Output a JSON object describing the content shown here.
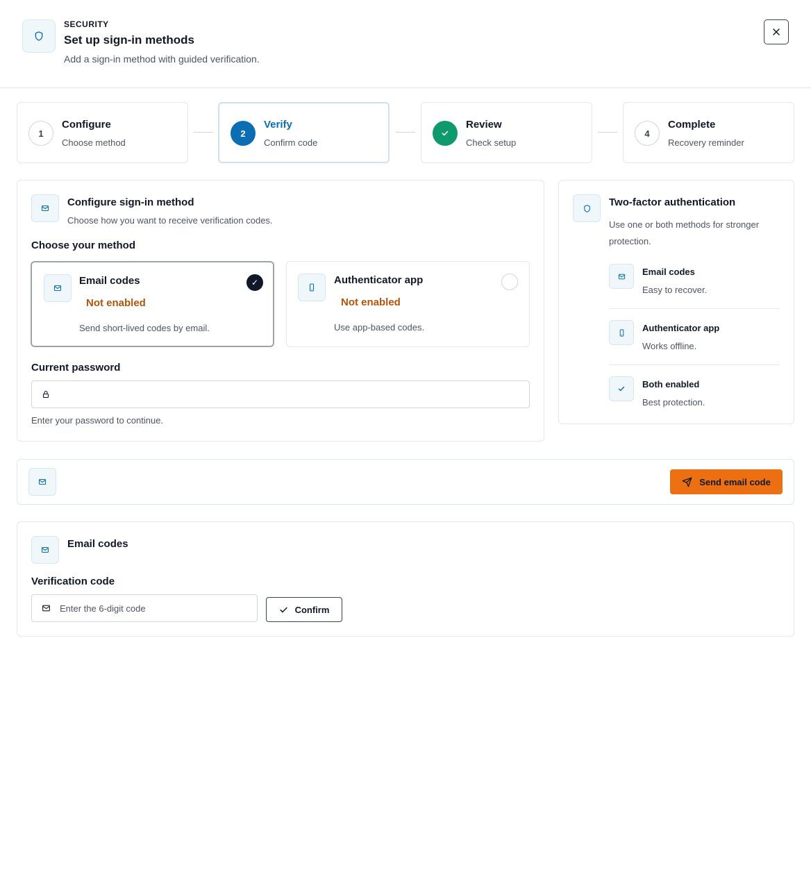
{
  "header": {
    "eyebrow": "SECURITY",
    "title": "Set up sign-in methods",
    "subtitle": "Add a sign-in method with guided verification.",
    "icon": "shield-icon",
    "close_icon": "close-icon"
  },
  "steps": [
    {
      "number": "1",
      "title": "Configure",
      "subtitle": "Choose method",
      "state": "default"
    },
    {
      "number": "2",
      "title": "Verify",
      "subtitle": "Confirm code",
      "state": "active"
    },
    {
      "number": "",
      "title": "Review",
      "subtitle": "Check setup",
      "state": "done"
    },
    {
      "number": "4",
      "title": "Complete",
      "subtitle": "Recovery reminder",
      "state": "default"
    }
  ],
  "configure": {
    "title": "Configure sign-in method",
    "subtitle": "Choose how you want to receive verification codes.",
    "choose_label": "Choose your method",
    "methods": [
      {
        "title": "Email codes",
        "status": "Not enabled",
        "description": "Send short-lived codes by email.",
        "selected": true,
        "icon": "mail-icon"
      },
      {
        "title": "Authenticator app",
        "status": "Not enabled",
        "description": "Use app-based codes.",
        "selected": false,
        "icon": "phone-icon"
      }
    ],
    "password_label": "Current password",
    "password_value": "",
    "password_hint": "Enter your password to continue."
  },
  "sidebar": {
    "title": "Two-factor authentication",
    "description": "Use one or both methods for stronger protection.",
    "items": [
      {
        "title": "Email codes",
        "subtitle": "Easy to recover.",
        "icon": "mail-icon"
      },
      {
        "title": "Authenticator app",
        "subtitle": "Works offline.",
        "icon": "phone-icon"
      },
      {
        "title": "Both enabled",
        "subtitle": "Best protection.",
        "icon": "check-icon"
      }
    ]
  },
  "send_bar": {
    "button_label": "Send email code",
    "icon": "mail-icon",
    "button_icon": "send-icon"
  },
  "verify": {
    "title": "Email codes",
    "code_label": "Verification code",
    "code_placeholder": "Enter the 6-digit code",
    "code_value": "",
    "confirm_label": "Confirm"
  },
  "colors": {
    "accent": "#0b6eb4",
    "success": "#0e9a6a",
    "warning": "#b45309",
    "primary_button": "#ec6f12"
  }
}
